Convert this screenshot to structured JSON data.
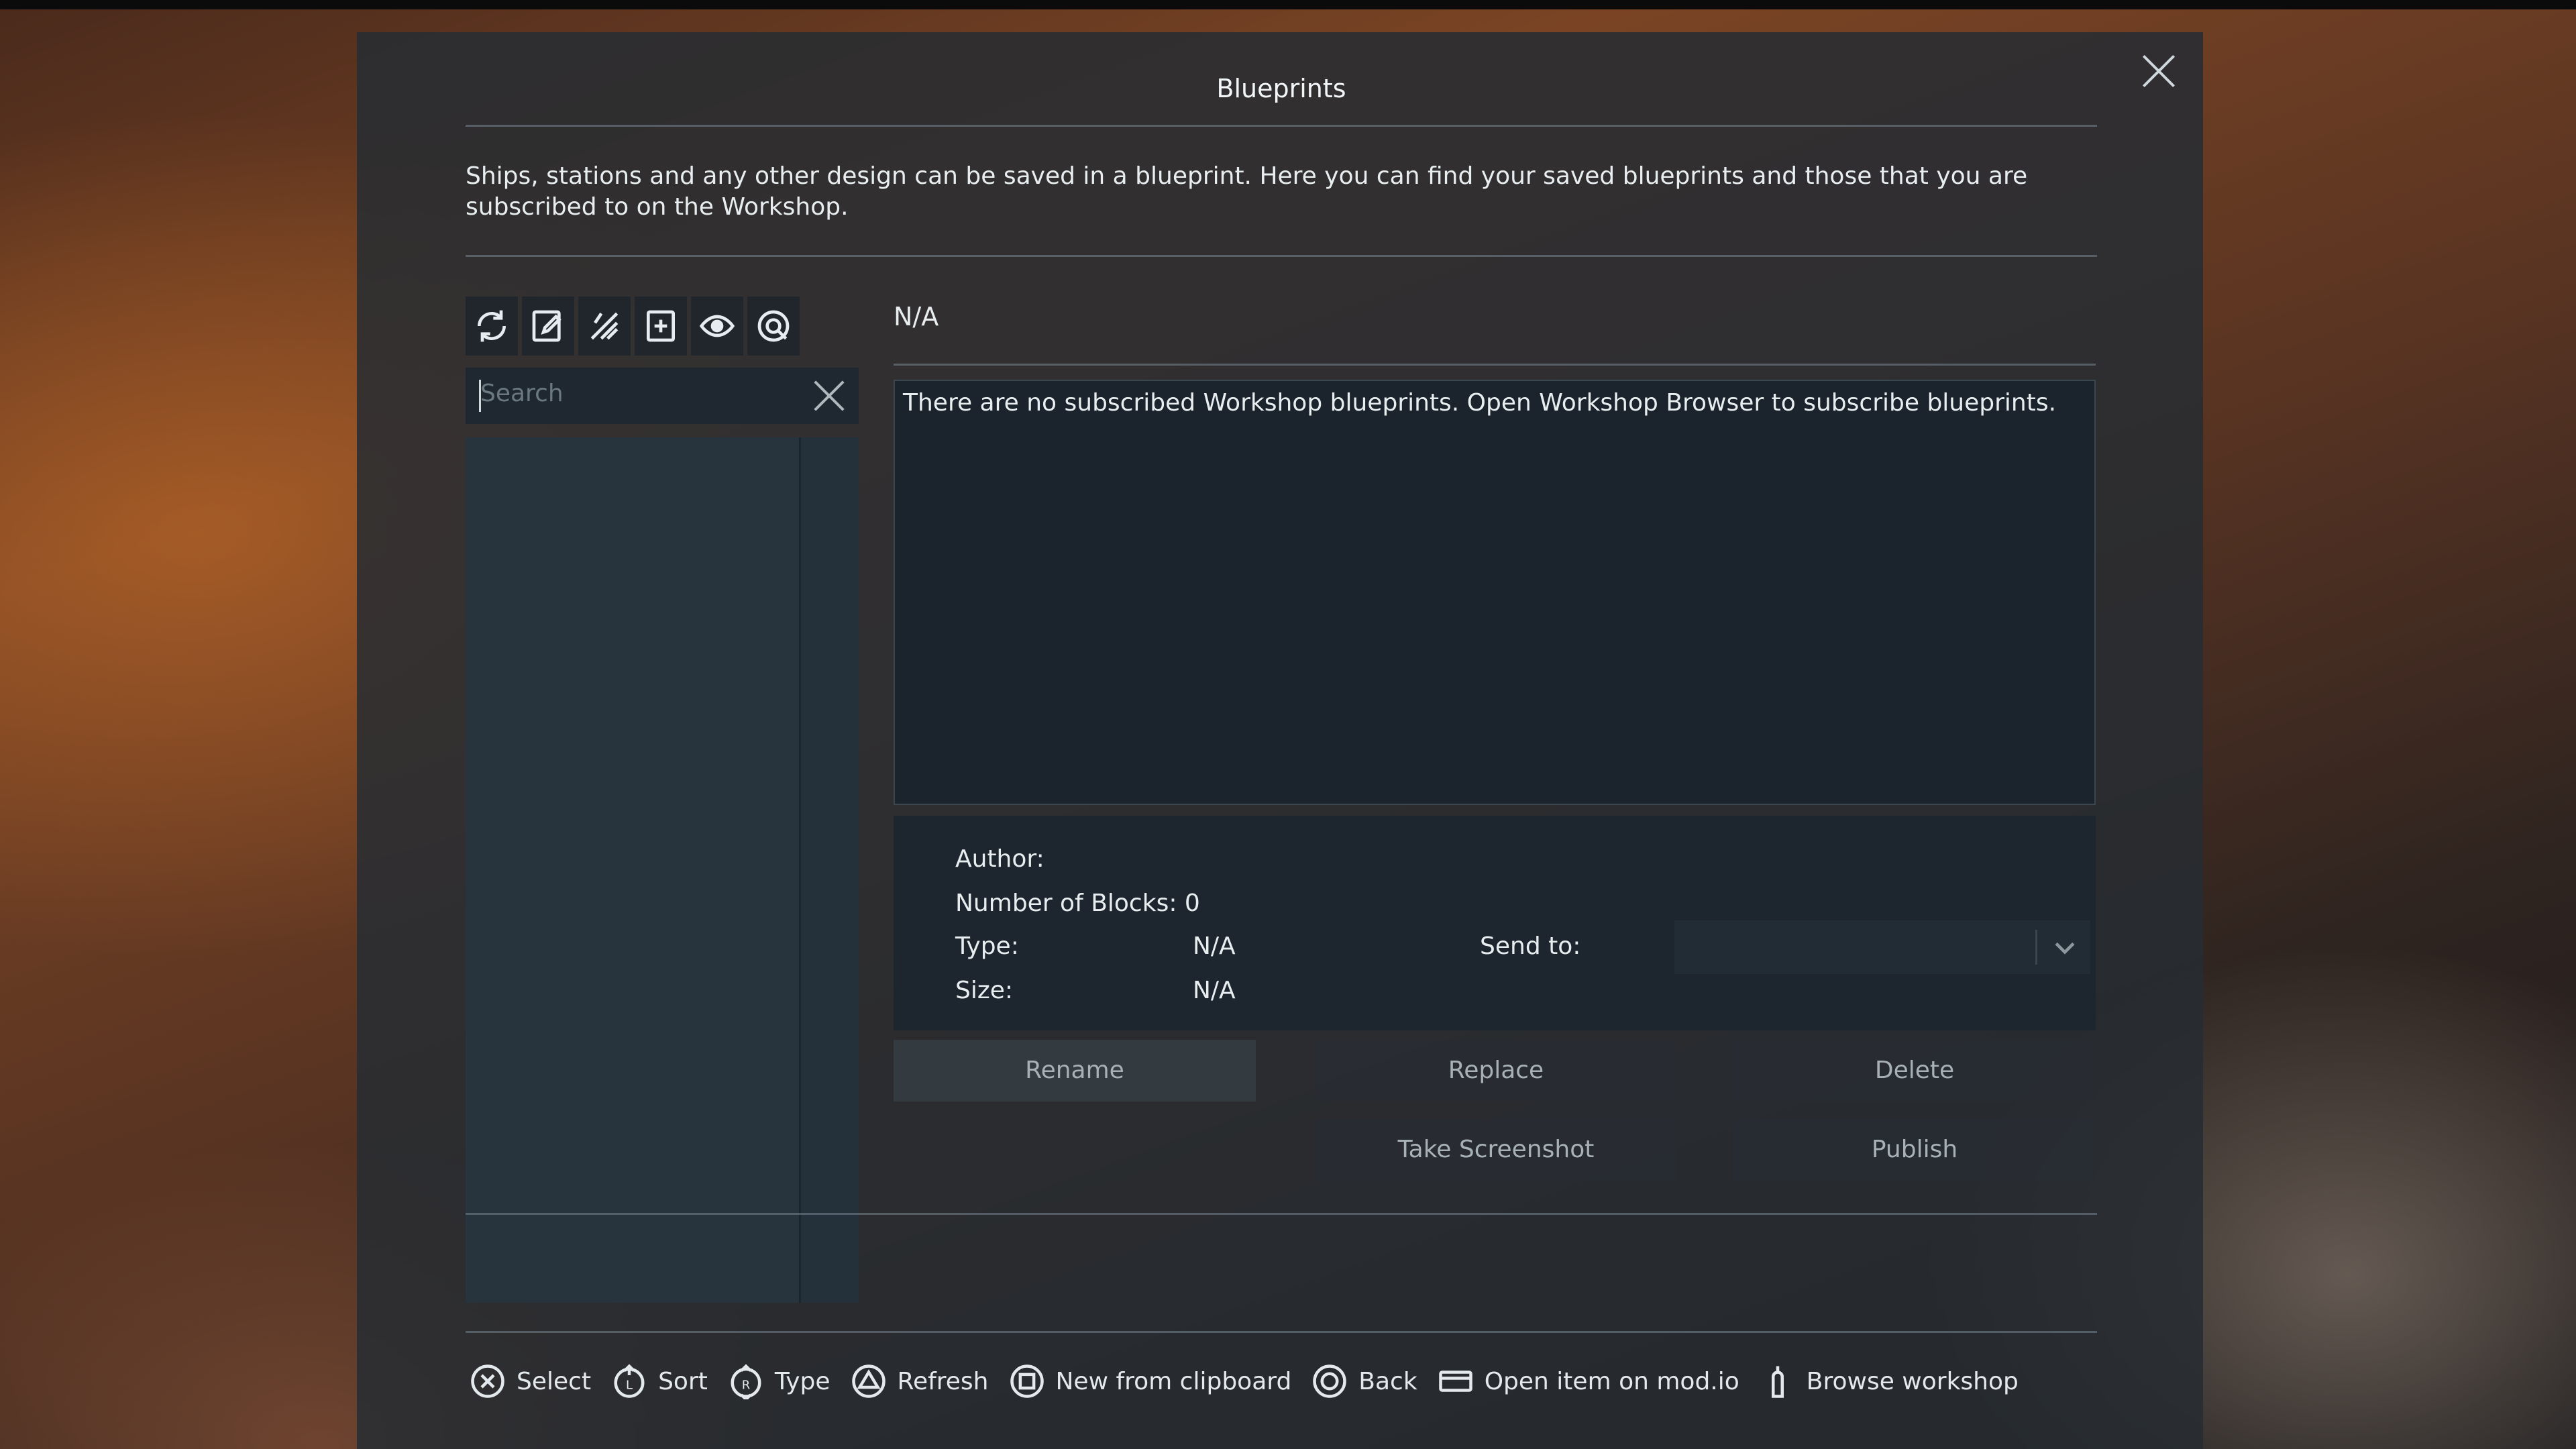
{
  "dialog": {
    "title": "Blueprints",
    "description": "Ships, stations and any other design can be saved in a blueprint. Here you can find your saved blueprints and those that you are subscribed to on the Workshop."
  },
  "toolbar": {
    "icons": [
      "refresh-icon",
      "edit-blueprint-icon",
      "clear-icon",
      "new-blueprint-icon",
      "eye-icon",
      "workshop-icon"
    ]
  },
  "search": {
    "placeholder": "Search",
    "value": ""
  },
  "selected": {
    "name": "N/A",
    "description": "There are no subscribed Workshop blueprints. Open Workshop Browser to subscribe blueprints."
  },
  "details": {
    "author_label": "Author:",
    "author_value": "",
    "blocks_label": "Number of Blocks: 0",
    "type_label": "Type:",
    "type_value": "N/A",
    "size_label": "Size:",
    "size_value": "N/A",
    "sendto_label": "Send to:",
    "sendto_value": ""
  },
  "buttons": {
    "rename": "Rename",
    "replace": "Replace",
    "delete": "Delete",
    "take_screenshot": "Take Screenshot",
    "publish": "Publish"
  },
  "hints": [
    {
      "icon": "cross-button-icon",
      "label": "Select"
    },
    {
      "icon": "left-stick-icon",
      "label": "Sort"
    },
    {
      "icon": "right-stick-icon",
      "label": "Type"
    },
    {
      "icon": "triangle-button-icon",
      "label": "Refresh"
    },
    {
      "icon": "square-button-icon",
      "label": "New from clipboard"
    },
    {
      "icon": "circle-button-icon",
      "label": "Back"
    },
    {
      "icon": "touchpad-icon",
      "label": "Open item on mod.io"
    },
    {
      "icon": "trigger-icon",
      "label": "Browse workshop"
    }
  ]
}
